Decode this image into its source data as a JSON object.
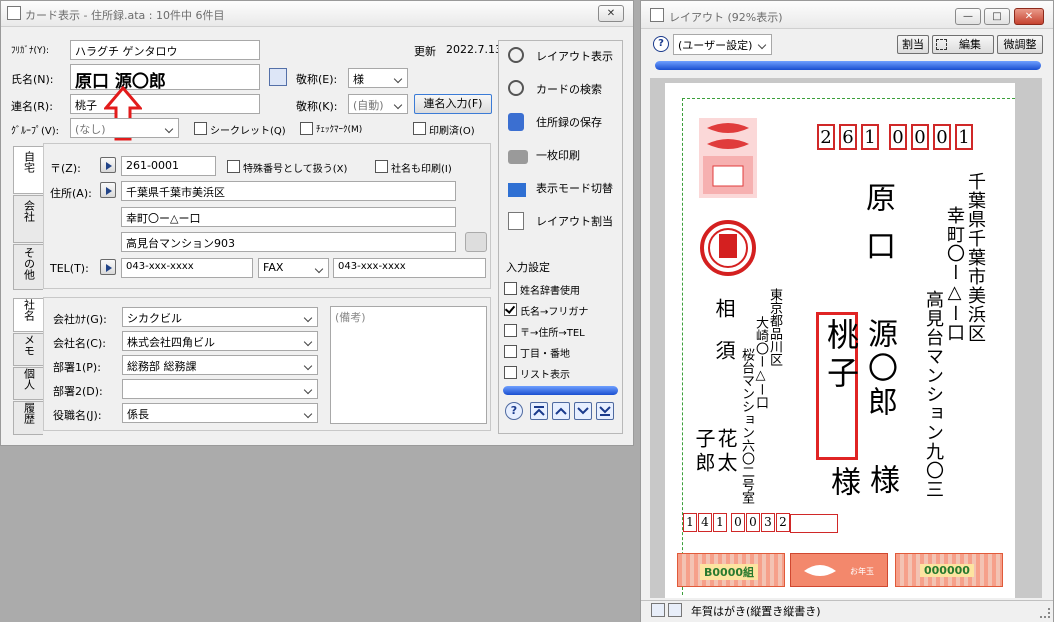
{
  "card_window": {
    "title": "カード表示 - 住所録.ata : 10件中 6件目",
    "furigana_label": "ﾌﾘｶﾞﾅ(Y):",
    "furigana_value": "ハラグチ ゲンタロウ",
    "updated_label": "更新",
    "updated_value": "2022.7.13",
    "name_label": "氏名(N):",
    "name_value": "原口 源〇郎",
    "honorific_label": "敬称(E):",
    "honorific_value": "様",
    "joint_label": "連名(R):",
    "joint_value": "桃子",
    "joint_honorific_label": "敬称(K):",
    "joint_honorific_value": "(自動)",
    "joint_input_button": "連名入力(F)",
    "group_label": "ｸﾞﾙｰﾌﾟ(V):",
    "group_value": "(なし)",
    "secret_label": "シークレット(Q)",
    "checkmark_label": "ﾁｪｯｸﾏｰｸ(M)",
    "printed_label": "印刷済(O)",
    "side_tabs": [
      "自宅",
      "会社",
      "その他"
    ],
    "zip_label": "〒(Z):",
    "zip_value": "261-0001",
    "special_no_label": "特殊番号として扱う(X)",
    "company_print_label": "社名も印刷(I)",
    "address_label": "住所(A):",
    "address1": "千葉県千葉市美浜区",
    "address2": "幸町〇ー△ー口",
    "address3": "高見台マンション903",
    "tel_label": "TEL(T):",
    "tel_value": "043-xxx-xxxx",
    "fax_type": "FAX",
    "fax_value": "043-xxx-xxxx",
    "bottom_tabs": [
      "社名",
      "メモ",
      "個人",
      "履歴"
    ],
    "company_kana_label": "会社ｶﾅ(G):",
    "company_kana_value": "シカクビル",
    "company_name_label": "会社名(C):",
    "company_name_value": "株式会社四角ビル",
    "dept1_label": "部署1(P):",
    "dept1_value": "総務部 総務課",
    "dept2_label": "部署2(D):",
    "dept2_value": "",
    "position_label": "役職名(J):",
    "position_value": "係長",
    "memo_placeholder": "(備考)",
    "commands": [
      "レイアウト表示",
      "カードの検索",
      "住所録の保存",
      "一枚印刷",
      "表示モード切替",
      "レイアウト割当"
    ],
    "input_settings_title": "入力設定",
    "input_settings": [
      {
        "label": "姓名辞書使用",
        "checked": false
      },
      {
        "label": "氏名→フリガナ",
        "checked": true
      },
      {
        "label": "〒→住所→TEL",
        "checked": false
      },
      {
        "label": "丁目・番地",
        "checked": false
      },
      {
        "label": "リスト表示",
        "checked": false
      }
    ]
  },
  "layout_window": {
    "title": "レイアウト (92%表示)",
    "preset_value": "(ユーザー設定)",
    "toolbar": [
      "割当",
      "編集",
      "微調整"
    ],
    "status_text": "年賀はがき(縦置き縦書き)",
    "postcard": {
      "zip_digits": [
        "2",
        "6",
        "1",
        "0",
        "0",
        "0",
        "1"
      ],
      "address_line1": "千葉県千葉市美浜区",
      "address_line2": "幸町〇ー△ー口",
      "address_line3": "高見台マンション九〇三",
      "name_surname": "原口",
      "name_given": "源〇郎",
      "name_honorific": "様",
      "joint_name": "桃子",
      "joint_honorific": "様",
      "sender_address1": "東京都品川区",
      "sender_address2": "大崎〇ー△ー口",
      "sender_address3": "桜台マンション六〇二号室",
      "sender_name1": "相須",
      "sender_name2": "花太",
      "sender_name3": "子郎",
      "sender_zip": [
        "1",
        "4",
        "1",
        "0",
        "0",
        "3",
        "2"
      ],
      "stamp_text": "B0000組",
      "stamp2_text": "お年玉",
      "stamp3_text": "000000"
    }
  }
}
